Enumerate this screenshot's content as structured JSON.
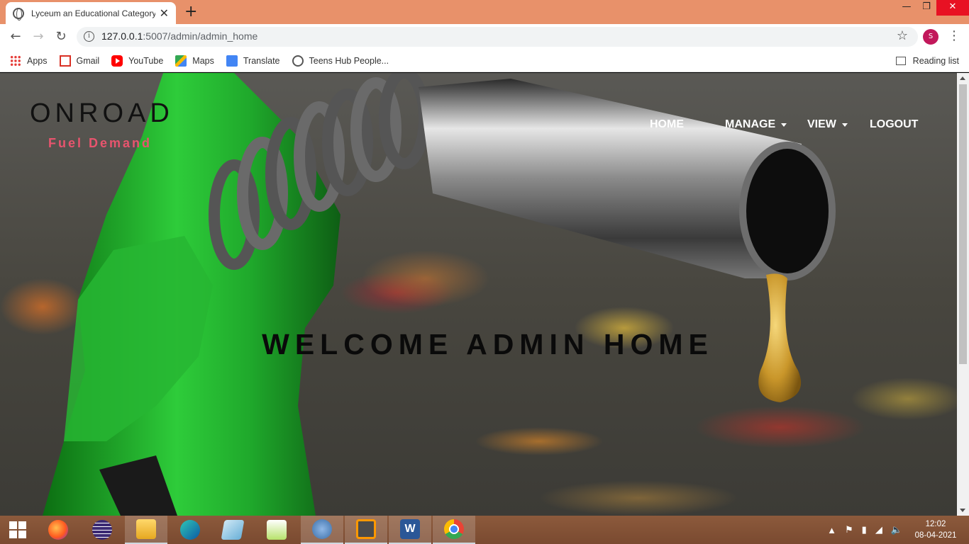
{
  "browser": {
    "tab_title": "Lyceum an Educational Category",
    "tab_close": "✕",
    "new_tab": "+",
    "url_host": "127.0.0.1",
    "url_path": ":5007/admin/admin_home",
    "profile_initial": "S",
    "window_minimize": "—",
    "window_restore": "❐",
    "window_close": "✕"
  },
  "bookmarks": {
    "items": [
      {
        "label": "Apps",
        "icon": "apps-grid-icon"
      },
      {
        "label": "Gmail",
        "icon": "gmail-icon"
      },
      {
        "label": "YouTube",
        "icon": "youtube-icon"
      },
      {
        "label": "Maps",
        "icon": "maps-icon"
      },
      {
        "label": "Translate",
        "icon": "translate-icon"
      },
      {
        "label": "Teens Hub People...",
        "icon": "globe-icon"
      }
    ],
    "reading_list": "Reading list"
  },
  "site": {
    "logo_title": "ONROAD",
    "logo_subtitle": "Fuel Demand",
    "nav": {
      "home": "HOME",
      "manage": "MANAGE",
      "view": "VIEW",
      "logout": "LOGOUT"
    },
    "welcome": "WELCOME ADMIN HOME",
    "accent_color": "#e8546e"
  },
  "taskbar": {
    "apps": [
      "windows-start",
      "firefox",
      "eclipse",
      "file-explorer",
      "edge",
      "notepad-plus",
      "notepad-edit",
      "mysql-workbench",
      "sublime-text",
      "word",
      "chrome"
    ],
    "time": "12:02",
    "date": "08-04-2021"
  }
}
